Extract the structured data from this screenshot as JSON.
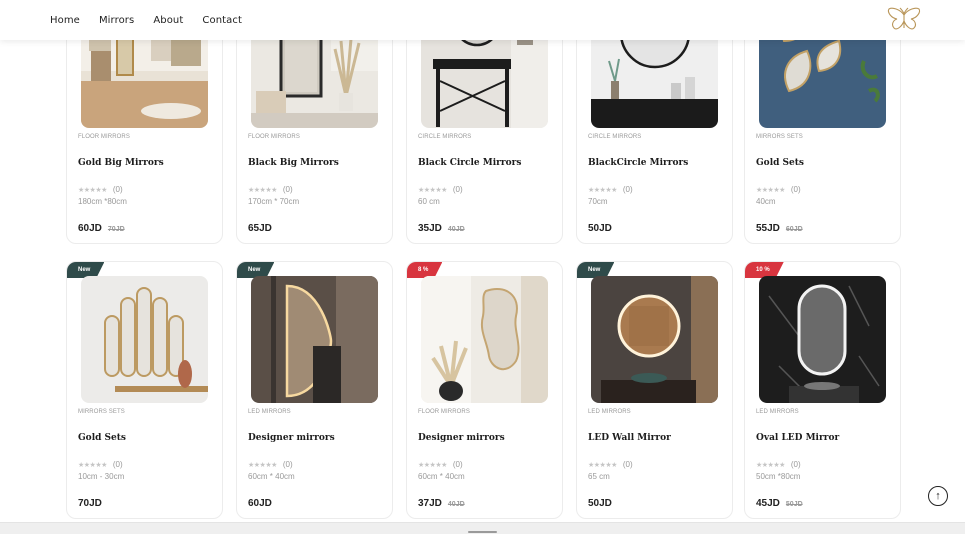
{
  "nav": {
    "items": [
      "Home",
      "Mirrors",
      "About",
      "Contact"
    ]
  },
  "logo": {
    "icon": "butterfly-icon",
    "color": "#b9965a"
  },
  "colors": {
    "badge_new": "#2f4b4a",
    "badge_sale": "#d8353f"
  },
  "products": [
    {
      "category": "FLOOR MIRRORS",
      "title": "Gold Big Mirrors",
      "rating": "★★★★★",
      "reviews": "(0)",
      "size": "180cm *80cm",
      "price": "60JD",
      "old_price": "70JD",
      "badge": ""
    },
    {
      "category": "FLOOR MIRRORS",
      "title": "Black Big Mirrors",
      "rating": "★★★★★",
      "reviews": "(0)",
      "size": "170cm * 70cm",
      "price": "65JD",
      "old_price": "",
      "badge": ""
    },
    {
      "category": "CIRCLE MIRRORS",
      "title": "Black Circle Mirrors",
      "rating": "★★★★★",
      "reviews": "(0)",
      "size": "60 cm",
      "price": "35JD",
      "old_price": "40JD",
      "badge": ""
    },
    {
      "category": "CIRCLE MIRRORS",
      "title": "BlackCircle Mirrors",
      "rating": "★★★★★",
      "reviews": "(0)",
      "size": "70cm",
      "price": "50JD",
      "old_price": "",
      "badge": ""
    },
    {
      "category": "MIRRORS SETS",
      "title": "Gold Sets",
      "rating": "★★★★★",
      "reviews": "(0)",
      "size": "40cm",
      "price": "55JD",
      "old_price": "60JD",
      "badge": ""
    },
    {
      "category": "MIRRORS SETS",
      "title": "Gold Sets",
      "rating": "★★★★★",
      "reviews": "(0)",
      "size": "10cm - 30cm",
      "price": "70JD",
      "old_price": "",
      "badge": "New"
    },
    {
      "category": "LED MIRRORS",
      "title": "Designer mirrors",
      "rating": "★★★★★",
      "reviews": "(0)",
      "size": "60cm * 40cm",
      "price": "60JD",
      "old_price": "",
      "badge": "New"
    },
    {
      "category": "FLOOR MIRRORS",
      "title": "Designer mirrors",
      "rating": "★★★★★",
      "reviews": "(0)",
      "size": "60cm * 40cm",
      "price": "37JD",
      "old_price": "40JD",
      "badge": "8 %"
    },
    {
      "category": "LED MIRRORS",
      "title": "LED Wall Mirror",
      "rating": "★★★★★",
      "reviews": "(0)",
      "size": "65 cm",
      "price": "50JD",
      "old_price": "",
      "badge": "New"
    },
    {
      "category": "LED MIRRORS",
      "title": "Oval LED Mirror",
      "rating": "★★★★★",
      "reviews": "(0)",
      "size": "50cm *80cm",
      "price": "45JD",
      "old_price": "50JD",
      "badge": "10 %"
    }
  ],
  "scroll_top": {
    "icon": "arrow-up-icon",
    "glyph": "↑"
  }
}
